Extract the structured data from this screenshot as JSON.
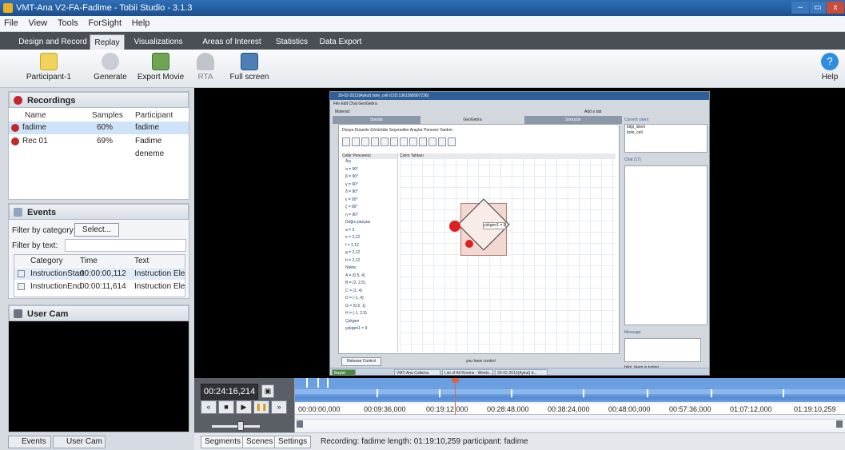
{
  "window": {
    "title": "VMT-Ana V2-FA-Fadime - Tobii Studio - 3.1.3",
    "min": "–",
    "max": "▭",
    "close": "x"
  },
  "menu": [
    "File",
    "View",
    "Tools",
    "ForSight",
    "Help"
  ],
  "tabs": [
    "Design and Record",
    "Replay",
    "Visualizations",
    "Areas of Interest",
    "Statistics",
    "Data Export"
  ],
  "active_tab": "Replay",
  "ribbon": {
    "participant": "Participant-1",
    "generate": "Generate",
    "export_movie": "Export Movie",
    "rta": "RTA",
    "full_screen": "Full screen",
    "help": "Help"
  },
  "recordings": {
    "header": "Recordings",
    "columns": [
      "Name",
      "Samples",
      "Participant"
    ],
    "rows": [
      {
        "name": "fadime",
        "samples": "60%",
        "participant": "fadime"
      },
      {
        "name": "Rec 01",
        "samples": "69%",
        "participant": "Fadime deneme"
      }
    ]
  },
  "events": {
    "header": "Events",
    "filter_category_label": "Filter by category:",
    "select_button": "Select...",
    "filter_text_label": "Filter by text:",
    "columns": [
      "Category",
      "Time",
      "Text"
    ],
    "rows": [
      {
        "category": "InstructionStart",
        "time": "00:00:00,112",
        "text": "Instruction Ele..."
      },
      {
        "category": "InstructionEnd",
        "time": "00:00:11,614",
        "text": "Instruction Ele..."
      }
    ]
  },
  "usercam": {
    "header": "User Cam"
  },
  "left_tabs": [
    "Events",
    "User Cam"
  ],
  "vmt": {
    "title": "20-02-2013(Aykut) bole_cell (CID:1361368907236)",
    "menu": "File  Edit  Chat  GeoGebra",
    "material": "Material:",
    "tabs": [
      "Sorular",
      "GeoGebra",
      "Sonuclar"
    ],
    "add_tab": "Add a tab",
    "ggb_menu": "Dosya  Düzenle  Görüntüle  Seçenekler  Araçlar  Pencere  Yardım",
    "algebra_header": "Cebir Penceresi",
    "graphics_header": "Çizim Tahtası",
    "algebra_items": [
      "Açı",
      "α = 90°",
      "β = 90°",
      "γ = 90°",
      "δ = 90°",
      "ε = 90°",
      "ζ = 90°",
      "η = 90°",
      "Doğru parçası",
      "a = 3",
      "e = 2,12",
      "f = 2,12",
      "g = 2,12",
      "h = 2,12",
      "Nokta",
      "A = (0.5, 4)",
      "B = (2, 2.5)",
      "C = (2, 4)",
      "D = (-1, 4)",
      "G = (0.5, 1)",
      "H = (-1, 2.5)",
      "Çokgen",
      "çokgen1 = 9"
    ],
    "shape_label": "çokgen1 = 9",
    "current_users_label": "Current users:",
    "users": [
      "bilgi_islem",
      "bole_cell"
    ],
    "chat_label": "Chat (17)",
    "message_label": "Message:",
    "release_control": "Release Control",
    "you_have_control": "you have control",
    "typing": "bilgi_islem is typing",
    "taskbar": [
      "Başlat",
      "VMT-Ana Calisma",
      "List of All Rooms - Windo...",
      "20-02-2013(Aykut) b..."
    ]
  },
  "playback": {
    "time": "00:24:16,214"
  },
  "timeline": {
    "ticks": [
      "00:00:00,000",
      "00:09:36,000",
      "00:19:12,000",
      "00:28:48,000",
      "00:38:24,000",
      "00:48:00,000",
      "00:57:36,000",
      "01:07:12,000",
      "01:19:10,259"
    ]
  },
  "status": {
    "tabs": [
      "Segments",
      "Scenes",
      "Settings"
    ],
    "text": "Recording: fadime length: 01:19:10,259 participant: fadime"
  }
}
